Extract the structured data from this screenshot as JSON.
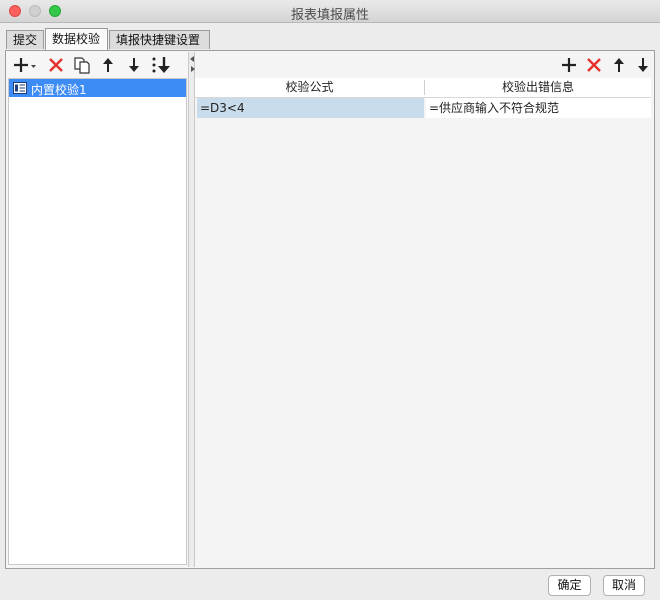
{
  "window": {
    "title": "报表填报属性"
  },
  "tabs": [
    {
      "label": "提交"
    },
    {
      "label": "数据校验"
    },
    {
      "label": "填报快捷键设置"
    }
  ],
  "left_toolbar": {
    "buttons": [
      "add-menu-icon",
      "delete-icon",
      "copy-icon",
      "move-up-icon",
      "move-down-icon",
      "move-to-bottom-icon"
    ]
  },
  "tree": {
    "items": [
      {
        "label": "内置校验1",
        "icon": "validation-item-icon",
        "selected": true
      }
    ]
  },
  "right_toolbar": {
    "buttons": [
      "add-icon",
      "delete-icon",
      "move-up-icon",
      "move-down-icon"
    ]
  },
  "grid": {
    "columns": [
      "校验公式",
      "校验出错信息"
    ],
    "rows": [
      {
        "formula": "=D3<4",
        "message": "=供应商输入不符合规范"
      }
    ]
  },
  "footer": {
    "ok_label": "确定",
    "cancel_label": "取消"
  },
  "colors": {
    "selection": "#3d8bf5",
    "delete": "#e5312b",
    "cell_selected": "#c8dcec"
  }
}
